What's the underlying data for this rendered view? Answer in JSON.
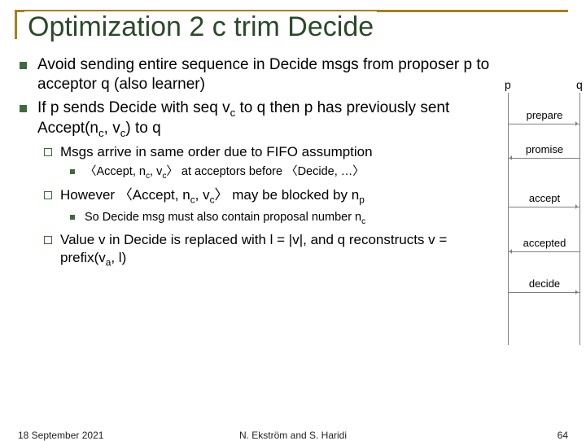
{
  "title": "Optimization 2 c trim Decide",
  "bullets": {
    "b1": "Avoid sending entire sequence in Decide msgs from proposer p to acceptor q (also learner)",
    "b2_pre": "If p sends Decide with seq v",
    "b2_sub1": "c",
    "b2_mid": " to q then p has previously sent Accept(n",
    "b2_sub2": "c",
    "b2_mid2": ", v",
    "b2_sub3": "c",
    "b2_post": ") to q",
    "b2a": "Msgs arrive in same order due to FIFO assumption",
    "b2a1_pre": "〈Accept, n",
    "b2a1_s1": "c",
    "b2a1_m1": ", v",
    "b2a1_s2": "c",
    "b2a1_post": "〉 at acceptors before 〈Decide, …〉",
    "b2b_pre": "However 〈Accept, n",
    "b2b_s1": "c",
    "b2b_m1": ", v",
    "b2b_s2": "c",
    "b2b_m2": "〉 may be blocked by n",
    "b2b_s3": "p",
    "b2b1_pre": "So Decide msg must also contain proposal number n",
    "b2b1_s1": "c",
    "b2c_pre": "Value v in Decide is replaced with l = |v|, and q reconstructs v = prefix(v",
    "b2c_s1": "a",
    "b2c_post": ", l)"
  },
  "diagram": {
    "p": "p",
    "q": "q",
    "m1": "prepare",
    "m2": "promise",
    "m3": "accept",
    "m4": "accepted",
    "m5": "decide"
  },
  "footer": {
    "date": "18 September 2021",
    "authors": "N. Ekström and S. Haridi",
    "page": "64"
  }
}
